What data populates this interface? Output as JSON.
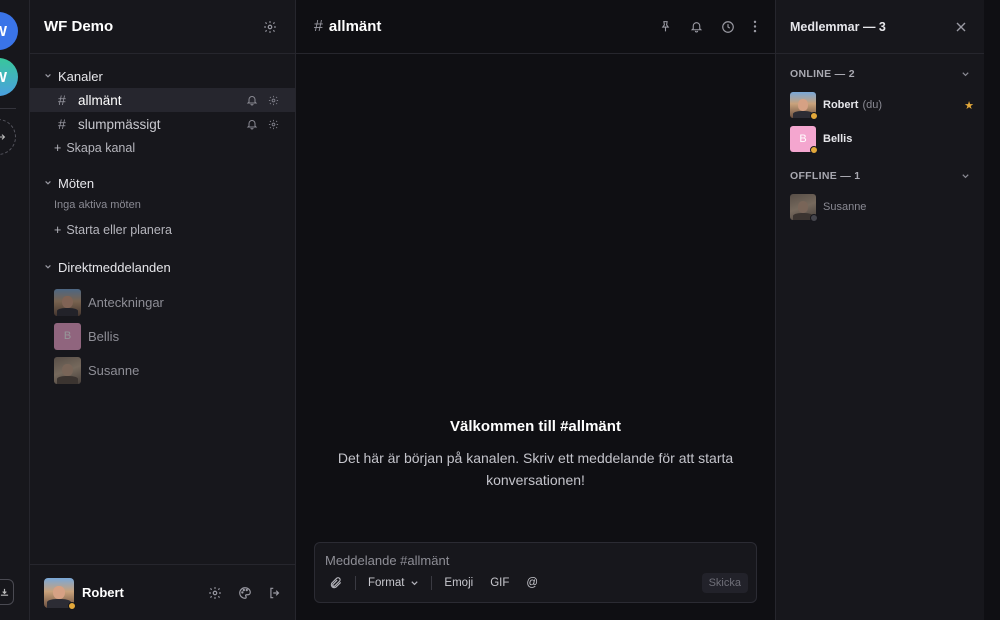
{
  "rail": {
    "servers": [
      {
        "letter": "W",
        "color": "#3a74e8"
      },
      {
        "letter": "W",
        "color": "#38c79b"
      }
    ],
    "add_icon": "arrow-right-icon",
    "bottom_icon": "download-icon"
  },
  "sidebar": {
    "title": "WF Demo",
    "channels_header": "Kanaler",
    "channels": [
      {
        "name": "allmänt",
        "active": true
      },
      {
        "name": "slumpmässigt",
        "active": false
      }
    ],
    "create_channel": "Skapa kanal",
    "meetings_header": "Möten",
    "no_meetings": "Inga aktiva möten",
    "start_meeting": "Starta eller planera",
    "dm_header": "Direktmeddelanden",
    "dms": [
      {
        "name": "Anteckningar"
      },
      {
        "name": "Bellis",
        "initial": "B"
      },
      {
        "name": "Susanne"
      }
    ],
    "footer_user": "Robert"
  },
  "main": {
    "channel_hash": "#",
    "channel_name": "allmänt",
    "welcome_title": "Välkommen till #allmänt",
    "welcome_text": "Det här är början på kanalen. Skriv ett meddelande för att starta konversationen!",
    "composer": {
      "placeholder": "Meddelande #allmänt",
      "format_label": "Format",
      "emoji_label": "Emoji",
      "gif_label": "GIF",
      "mention_label": "@",
      "send_label": "Skicka"
    }
  },
  "members": {
    "title": "Medlemmar — 3",
    "online_header": "ONLINE — 2",
    "offline_header": "OFFLINE — 1",
    "online": [
      {
        "name": "Robert",
        "suffix": "(du)"
      },
      {
        "name": "Bellis",
        "initial": "B"
      }
    ],
    "offline": [
      {
        "name": "Susanne"
      }
    ]
  },
  "colors": {
    "accent": "#3a74e8",
    "status_online": "#e3a83a",
    "bellis": "#f4a6cf"
  }
}
